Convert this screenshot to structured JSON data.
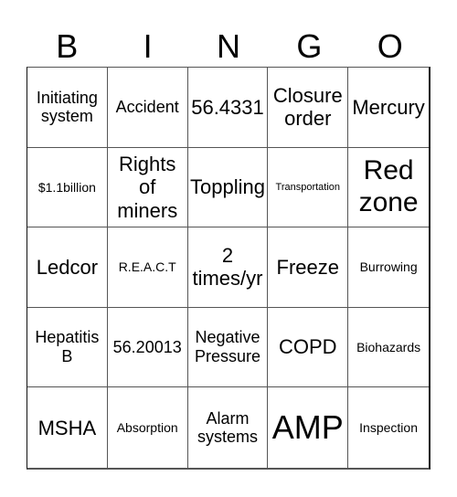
{
  "title_letters": [
    "B",
    "I",
    "N",
    "G",
    "O"
  ],
  "cells": [
    [
      {
        "text": "Initiating system",
        "size": "m"
      },
      {
        "text": "Accident",
        "size": "m"
      },
      {
        "text": "56.4331",
        "size": "l"
      },
      {
        "text": "Closure order",
        "size": "l"
      },
      {
        "text": "Mercury",
        "size": "l"
      }
    ],
    [
      {
        "text": "$1.1billion",
        "size": "s"
      },
      {
        "text": "Rights of miners",
        "size": "l"
      },
      {
        "text": "Toppling",
        "size": "l"
      },
      {
        "text": "Transportation",
        "size": "xs"
      },
      {
        "text": "Red zone",
        "size": "xl"
      }
    ],
    [
      {
        "text": "Ledcor",
        "size": "l"
      },
      {
        "text": "R.E.A.C.T",
        "size": "s"
      },
      {
        "text": "2 times/yr",
        "size": "l"
      },
      {
        "text": "Freeze",
        "size": "l"
      },
      {
        "text": "Burrowing",
        "size": "s"
      }
    ],
    [
      {
        "text": "Hepatitis B",
        "size": "m"
      },
      {
        "text": "56.20013",
        "size": "m"
      },
      {
        "text": "Negative Pressure",
        "size": "m"
      },
      {
        "text": "COPD",
        "size": "l"
      },
      {
        "text": "Biohazards",
        "size": "s"
      }
    ],
    [
      {
        "text": "MSHA",
        "size": "l"
      },
      {
        "text": "Absorption",
        "size": "s"
      },
      {
        "text": "Alarm systems",
        "size": "m"
      },
      {
        "text": "AMP",
        "size": "xxl"
      },
      {
        "text": "Inspection",
        "size": "s"
      }
    ]
  ]
}
